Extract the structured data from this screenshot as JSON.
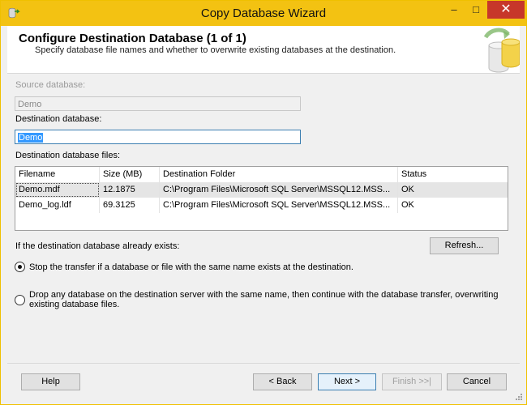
{
  "window": {
    "title": "Copy Database Wizard"
  },
  "header": {
    "title": "Configure Destination Database (1 of 1)",
    "subtitle": "Specify database file names and whether to overwrite existing databases at the destination."
  },
  "source": {
    "label": "Source database:",
    "value": "Demo"
  },
  "destination": {
    "label": "Destination database:",
    "value": "Demo"
  },
  "files": {
    "label": "Destination database files:",
    "columns": [
      "Filename",
      "Size (MB)",
      "Destination Folder",
      "Status"
    ],
    "rows": [
      [
        "Demo.mdf",
        "12.1875",
        "C:\\Program Files\\Microsoft SQL Server\\MSSQL12.MSS...",
        "OK"
      ],
      [
        "Demo_log.ldf",
        "69.3125",
        "C:\\Program Files\\Microsoft SQL Server\\MSSQL12.MSS...",
        "OK"
      ]
    ]
  },
  "exists": {
    "label": "If the destination database already exists:",
    "refresh": "Refresh..."
  },
  "options": {
    "stop": "Stop the transfer if a database or file with the same name exists at the destination.",
    "drop_line1": "Drop any database on the destination server with the same name, then continue with the database transfer, overwriting",
    "drop_line2": "existing database files.",
    "selected": "stop"
  },
  "footer": {
    "help": "Help",
    "back": "< Back",
    "next": "Next >",
    "finish": "Finish >>|",
    "cancel": "Cancel"
  },
  "colors": {
    "titlebar": "#f3c212",
    "close": "#c7372a",
    "selection": "#3399ff"
  }
}
